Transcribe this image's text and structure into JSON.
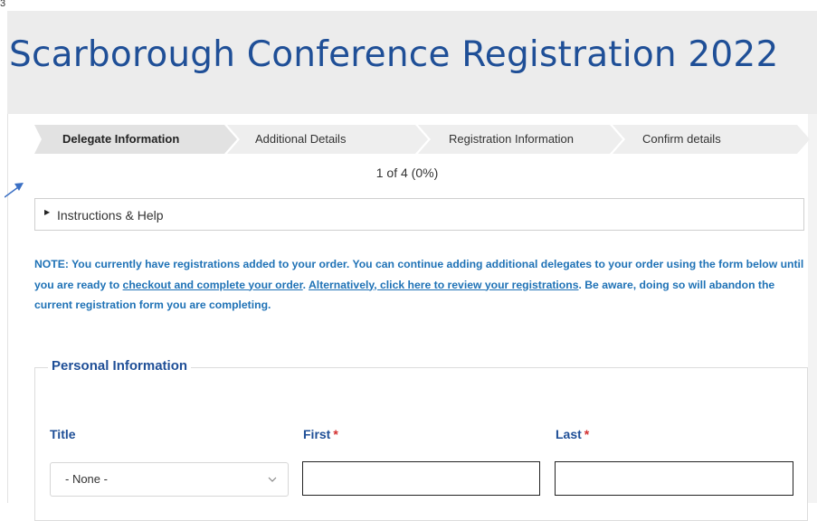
{
  "corner_digit": "3",
  "page_title": "Scarborough Conference Registration 2022",
  "wizard": {
    "steps": [
      {
        "label": "Delegate Information",
        "active": true
      },
      {
        "label": "Additional Details",
        "active": false
      },
      {
        "label": "Registration Information",
        "active": false
      },
      {
        "label": "Confirm details",
        "active": false
      }
    ],
    "progress_text": "1 of 4 (0%)"
  },
  "instructions": {
    "label": "Instructions & Help"
  },
  "note": {
    "part1": "NOTE: You currently have registrations added to your order. You can continue adding additional delegates to your order using the form below until you are ready to ",
    "link_checkout": "checkout and complete your order",
    "part2": ". ",
    "link_review": "Alternatively, click here to review your registrations",
    "part3": ". Be aware, doing so will abandon the current registration form you are completing."
  },
  "personal_info": {
    "legend": "Personal Information",
    "title_label": "Title",
    "title_value": "- None -",
    "first_label": "First",
    "last_label": "Last",
    "required_mark": "*",
    "first_value": "",
    "last_value": ""
  },
  "colors": {
    "title_blue": "#1f4f97",
    "note_blue": "#1f72b6",
    "required_red": "#d32f2f",
    "wizard_active": "#e2e2e2",
    "wizard_inactive": "#eeeeee"
  }
}
